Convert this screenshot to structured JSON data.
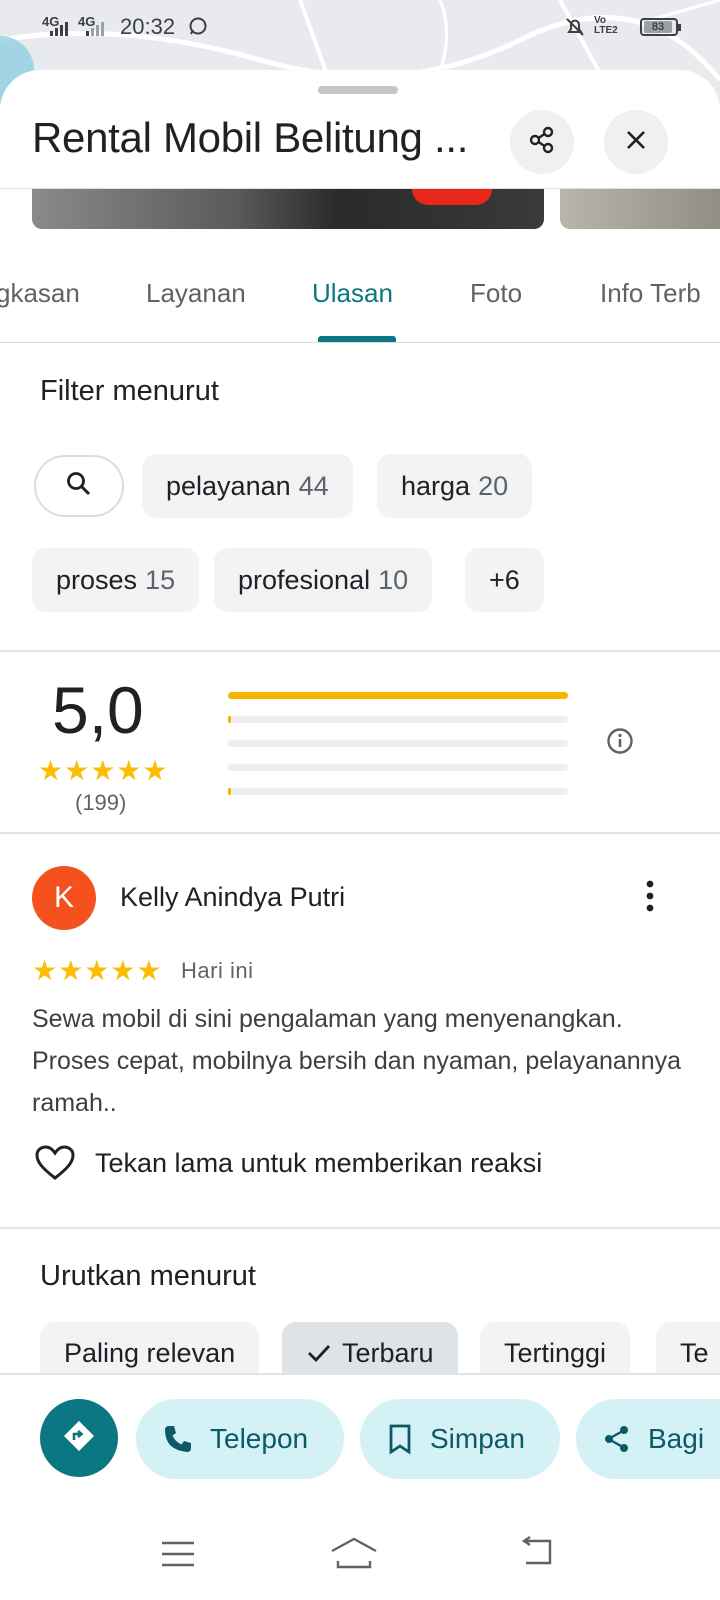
{
  "status_bar": {
    "network_1": "4G",
    "network_2": "4G",
    "time": "20:32",
    "volte": "Vo LTE2",
    "battery": "83"
  },
  "place": {
    "title": "Rental Mobil Belitung ..."
  },
  "tabs": [
    {
      "label": "gkasan"
    },
    {
      "label": "Layanan"
    },
    {
      "label": "Ulasan",
      "active": true
    },
    {
      "label": "Foto"
    },
    {
      "label": "Info Terb"
    }
  ],
  "filter": {
    "heading": "Filter menurut",
    "chips": [
      {
        "label": "pelayanan",
        "count": "44"
      },
      {
        "label": "harga",
        "count": "20"
      },
      {
        "label": "proses",
        "count": "15"
      },
      {
        "label": "profesional",
        "count": "10"
      },
      {
        "label": "+6",
        "count": ""
      }
    ]
  },
  "summary": {
    "rating": "5,0",
    "stars": "★★★★★",
    "count": "(199)",
    "distribution": [
      {
        "stars": 5,
        "fraction": 1.0
      },
      {
        "stars": 4,
        "fraction": 0.005
      },
      {
        "stars": 3,
        "fraction": 0.0
      },
      {
        "stars": 2,
        "fraction": 0.0
      },
      {
        "stars": 1,
        "fraction": 0.005
      }
    ]
  },
  "review": {
    "avatar_initial": "K",
    "author": "Kelly Anindya Putri",
    "stars": "★★★★★",
    "rating": 5,
    "date": "Hari ini",
    "text": "Sewa mobil di sini pengalaman yang menyenangkan. Proses cepat, mobilnya bersih dan nyaman, pelayanannya ramah..",
    "reaction_hint": "Tekan lama untuk memberikan reaksi"
  },
  "sort": {
    "heading": "Urutkan menurut",
    "options": [
      {
        "label": "Paling relevan"
      },
      {
        "label": "Terbaru",
        "selected": true
      },
      {
        "label": "Tertinggi"
      },
      {
        "label": "Te"
      }
    ]
  },
  "actions": {
    "call": "Telepon",
    "save": "Simpan",
    "share": "Bagi"
  },
  "colors": {
    "accent": "#0b7782",
    "star": "#fbbc04",
    "pill_bg": "#d4f1f6",
    "avatar_bg": "#f4511e"
  }
}
